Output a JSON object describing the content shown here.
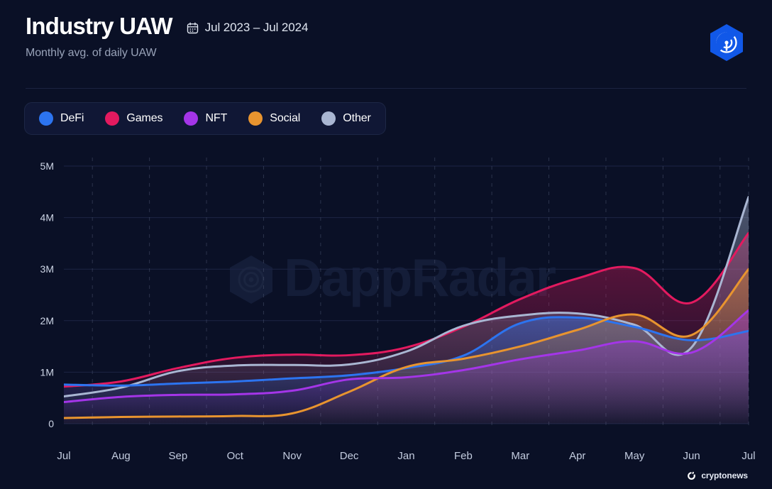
{
  "header": {
    "title": "Industry UAW",
    "date_range": "Jul 2023 – Jul 2024",
    "subtitle": "Monthly avg. of daily UAW",
    "calendar_icon": "calendar-icon",
    "brand_logo": "dappradar-logo"
  },
  "footer": {
    "attribution": "cryptonews",
    "icon": "cryptonews-icon"
  },
  "watermark": {
    "text": "DappRadar"
  },
  "colors": {
    "background": "#0a1026",
    "defi": "#2c74f0",
    "games": "#e31a5f",
    "nft": "#a435e8",
    "social": "#e8942f",
    "other": "#a9b6d2",
    "grid": "#1c2545",
    "grid_dash": "#47506b"
  },
  "chart_data": {
    "type": "line",
    "title": "Industry UAW",
    "subtitle": "Monthly avg. of daily UAW",
    "xlabel": "",
    "ylabel": "",
    "ylim": [
      0,
      5000000
    ],
    "yticks": [
      0,
      1000000,
      2000000,
      3000000,
      4000000,
      5000000
    ],
    "ytick_labels": [
      "0",
      "1M",
      "2M",
      "3M",
      "4M",
      "5M"
    ],
    "grid": true,
    "legend_position": "top-left",
    "categories": [
      "Jul",
      "Aug",
      "Sep",
      "Oct",
      "Nov",
      "Dec",
      "Jan",
      "Feb",
      "Mar",
      "Apr",
      "May",
      "Jun",
      "Jul"
    ],
    "x": [
      "Jul 2023",
      "Aug 2023",
      "Sep 2023",
      "Oct 2023",
      "Nov 2023",
      "Dec 2023",
      "Jan 2024",
      "Feb 2024",
      "Mar 2024",
      "Apr 2024",
      "May 2024",
      "Jun 2024",
      "Jul 2024"
    ],
    "series": [
      {
        "name": "DeFi",
        "color": "#2c74f0",
        "values": [
          760000,
          740000,
          780000,
          820000,
          880000,
          940000,
          1080000,
          1320000,
          1950000,
          2060000,
          1880000,
          1620000,
          1800000
        ]
      },
      {
        "name": "Games",
        "color": "#e31a5f",
        "values": [
          720000,
          820000,
          1080000,
          1280000,
          1340000,
          1330000,
          1480000,
          1880000,
          2420000,
          2820000,
          3020000,
          2350000,
          3700000
        ]
      },
      {
        "name": "NFT",
        "color": "#a435e8",
        "values": [
          420000,
          520000,
          560000,
          570000,
          640000,
          860000,
          900000,
          1040000,
          1250000,
          1420000,
          1600000,
          1380000,
          2200000
        ]
      },
      {
        "name": "Social",
        "color": "#e8942f",
        "values": [
          110000,
          130000,
          140000,
          150000,
          200000,
          620000,
          1100000,
          1260000,
          1500000,
          1820000,
          2120000,
          1720000,
          3000000
        ]
      },
      {
        "name": "Other",
        "color": "#a9b6d2",
        "values": [
          530000,
          700000,
          1020000,
          1130000,
          1140000,
          1150000,
          1400000,
          1900000,
          2100000,
          2140000,
          1920000,
          1480000,
          4400000
        ]
      }
    ]
  }
}
